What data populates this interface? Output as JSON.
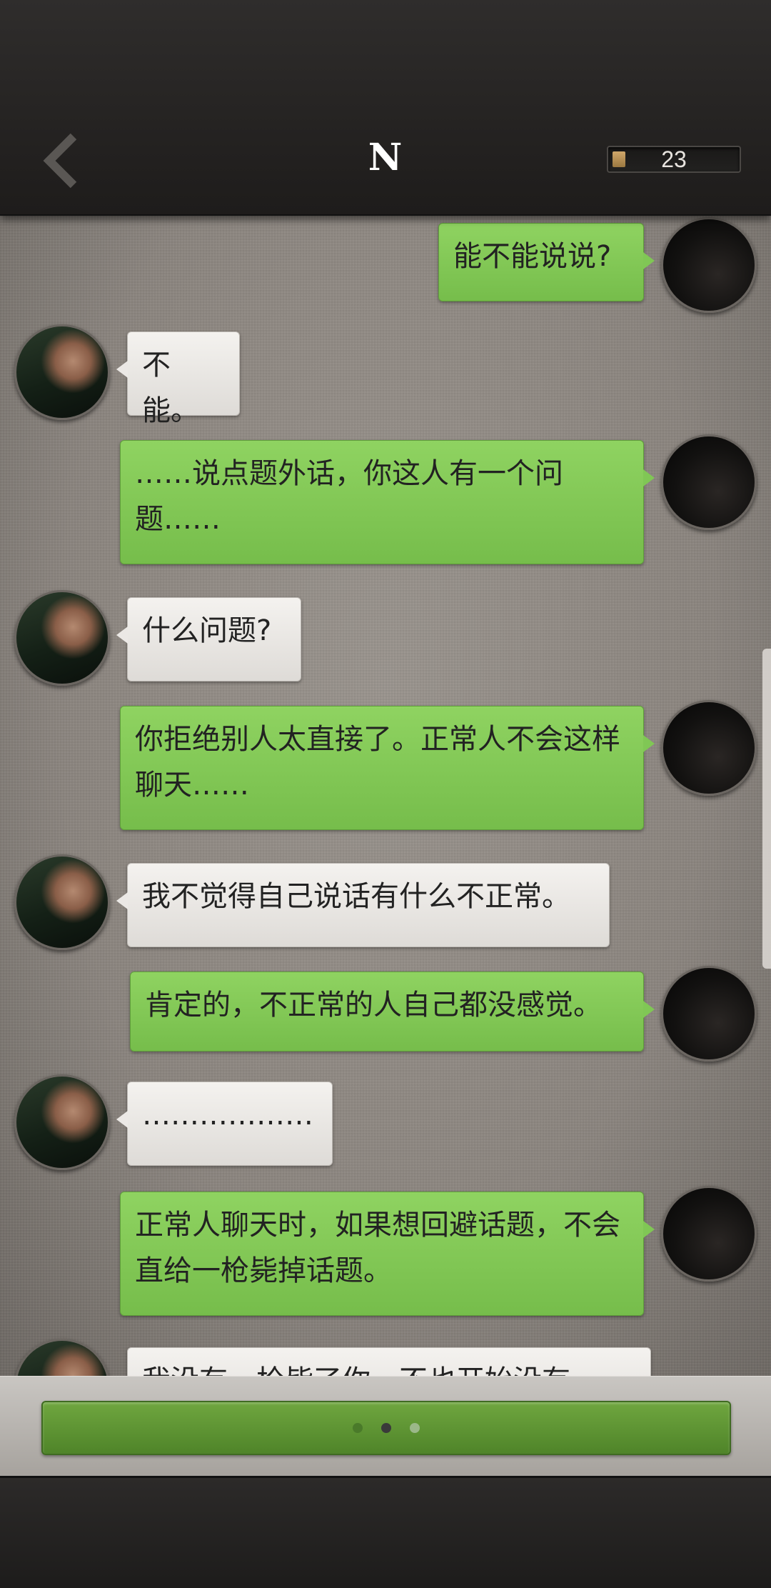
{
  "header": {
    "title": "N",
    "counter": "23"
  },
  "messages": [
    {
      "side": "me",
      "text": "能不能说说?"
    },
    {
      "side": "other",
      "text": "不能。"
    },
    {
      "side": "me",
      "text": "……说点题外话，你这人有一个问题……"
    },
    {
      "side": "other",
      "text": "什么问题?"
    },
    {
      "side": "me",
      "text": "你拒绝别人太直接了。正常人不会这样聊天……"
    },
    {
      "side": "other",
      "text": "我不觉得自己说话有什么不正常。"
    },
    {
      "side": "me",
      "text": "肯定的，不正常的人自己都没感觉。"
    },
    {
      "side": "other",
      "text": "………………"
    },
    {
      "side": "me",
      "text": "正常人聊天时，如果想回避话题，不会直给一枪毙掉话题。"
    },
    {
      "side": "other",
      "text": "我没有一枪毙了你，不也开始没有"
    }
  ],
  "colors": {
    "my_bubble": "#80c755",
    "other_bubble": "#ebe8e5",
    "accent_button": "#5f9535"
  }
}
